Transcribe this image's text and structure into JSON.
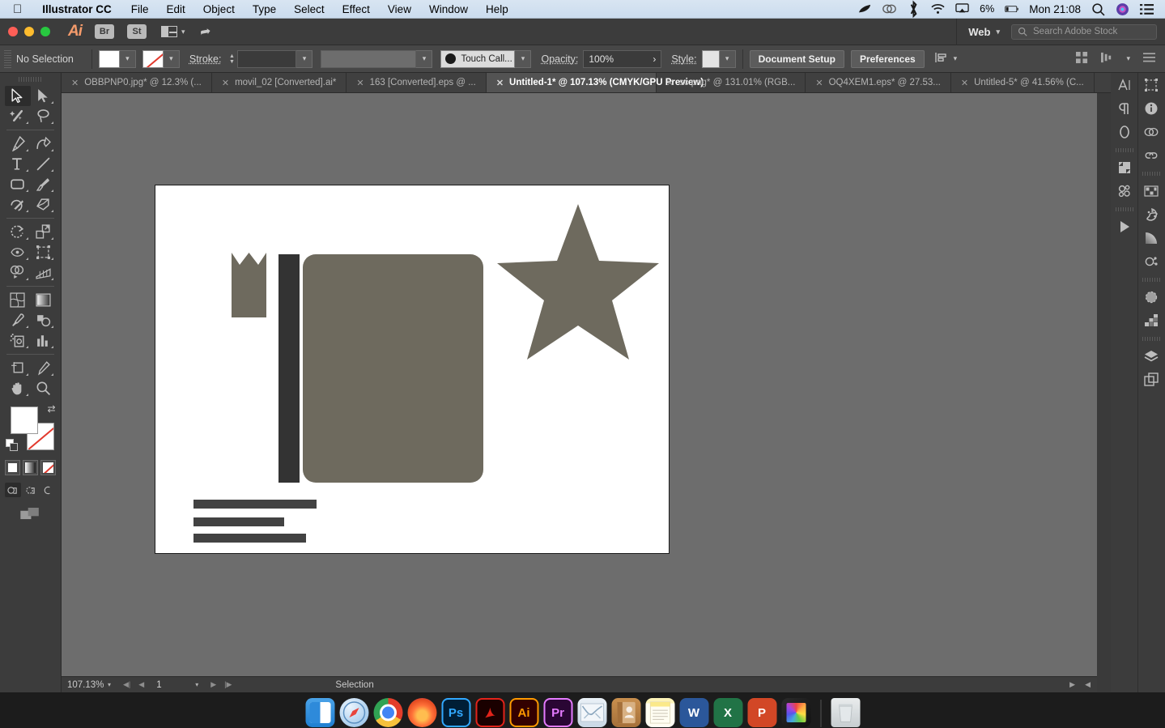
{
  "macos": {
    "apple_menu": "apple-logo",
    "app_name": "Illustrator CC",
    "menus": [
      "File",
      "Edit",
      "Object",
      "Type",
      "Select",
      "Effect",
      "View",
      "Window",
      "Help"
    ],
    "status_icons": [
      "feather-icon",
      "creative-cloud-icon",
      "bluetooth-icon",
      "wifi-icon",
      "airplay-icon"
    ],
    "battery_percent": "6%",
    "clock": "Mon 21:08",
    "right_icons": [
      "search-icon",
      "siri-icon",
      "notification-center-icon"
    ]
  },
  "app_bar": {
    "logo": "Ai",
    "bridge_label": "Br",
    "stock_label": "St",
    "arrange_icon": "arrange-documents-icon",
    "rocket_icon": "rocket-icon",
    "workspace": "Web",
    "search_placeholder": "Search Adobe Stock"
  },
  "control_bar": {
    "selection_status": "No Selection",
    "fill_swatch": "#ffffff",
    "stroke_swatch": "none",
    "stroke_label": "Stroke:",
    "stroke_weight": "",
    "stroke_profile": "",
    "brush_name": "Touch Call...",
    "opacity_label": "Opacity:",
    "opacity_value": "100%",
    "opacity_arrow": "›",
    "style_label": "Style:",
    "document_setup": "Document Setup",
    "preferences": "Preferences",
    "align_icon": "align-icon"
  },
  "tabs": [
    {
      "title": "OBBPNP0.jpg* @ 12.3% (...",
      "active": false
    },
    {
      "title": "movil_02 [Converted].ai*",
      "active": false
    },
    {
      "title": "163 [Converted].eps @ ...",
      "active": false
    },
    {
      "title": "Untitled-1* @ 107.13% (CMYK/GPU Preview)",
      "active": true
    },
    {
      "title": "sc.png* @ 131.01% (RGB...",
      "active": false
    },
    {
      "title": "OQ4XEM1.eps* @ 27.53...",
      "active": false
    },
    {
      "title": "Untitled-5* @ 41.56% (C...",
      "active": false
    }
  ],
  "tools": [
    {
      "name": "selection-tool",
      "active": true
    },
    {
      "name": "direct-selection-tool",
      "active": false
    },
    {
      "name": "magic-wand-tool",
      "active": false
    },
    {
      "name": "lasso-tool",
      "active": false
    },
    {
      "name": "pen-tool",
      "active": false
    },
    {
      "name": "curvature-tool",
      "active": false
    },
    {
      "name": "type-tool",
      "active": false
    },
    {
      "name": "line-segment-tool",
      "active": false
    },
    {
      "name": "rectangle-tool",
      "active": false
    },
    {
      "name": "paintbrush-tool",
      "active": false
    },
    {
      "name": "shaper-tool",
      "active": false
    },
    {
      "name": "eraser-tool",
      "active": false
    },
    {
      "name": "rotate-tool",
      "active": false
    },
    {
      "name": "scale-tool",
      "active": false
    },
    {
      "name": "width-tool",
      "active": false
    },
    {
      "name": "free-transform-tool",
      "active": false
    },
    {
      "name": "shape-builder-tool",
      "active": false
    },
    {
      "name": "perspective-grid-tool",
      "active": false
    },
    {
      "name": "mesh-tool",
      "active": false
    },
    {
      "name": "gradient-tool",
      "active": false
    },
    {
      "name": "eyedropper-tool",
      "active": false
    },
    {
      "name": "blend-tool",
      "active": false
    },
    {
      "name": "symbol-sprayer-tool",
      "active": false
    },
    {
      "name": "column-graph-tool",
      "active": false
    },
    {
      "name": "artboard-tool",
      "active": false
    },
    {
      "name": "slice-tool",
      "active": false
    },
    {
      "name": "hand-tool",
      "active": false
    },
    {
      "name": "zoom-tool",
      "active": false
    }
  ],
  "color_controls": {
    "fill": "#ffffff",
    "stroke": "none",
    "swap_icon": "swap-fill-stroke-icon",
    "default_icon": "default-fill-stroke-icon",
    "modes": [
      "color-mode-button",
      "gradient-mode-button",
      "none-mode-button"
    ],
    "draw_modes": [
      "draw-normal-button",
      "draw-behind-button",
      "draw-inside-button"
    ],
    "screen_mode": "change-screen-mode-button"
  },
  "artwork": {
    "fill_color": "#6e6a5e",
    "dark_color": "#333333",
    "text_bar_color": "#424242",
    "shapes": [
      "ribbon-bookmark",
      "book-spine",
      "book-cover",
      "star",
      "text-bar-1",
      "text-bar-2",
      "text-bar-3"
    ]
  },
  "status_bar": {
    "zoom_level": "107.13%",
    "artboard_number": "1",
    "tool_status": "Selection",
    "first_icon": "first-artboard-icon",
    "prev_icon": "prev-artboard-icon",
    "next_icon": "next-artboard-icon",
    "last_icon": "last-artboard-icon"
  },
  "right_dock": {
    "column_a": [
      "character-panel-icon",
      "paragraph-panel-icon",
      "opentype-panel-icon",
      "symbols-panel-icon",
      "brushes-panel-icon",
      "actions-panel-icon"
    ],
    "column_b": [
      "transform-panel-icon",
      "info-panel-icon",
      "cc-libraries-panel-icon",
      "links-panel-icon",
      "swatches-panel-icon",
      "color-guide-panel-icon",
      "gradient-panel-icon",
      "color-panel-icon",
      "appearance-panel-icon",
      "graphic-styles-panel-icon",
      "layers-panel-icon",
      "artboards-panel-icon"
    ]
  },
  "dock": {
    "apps": [
      {
        "name": "finder",
        "label": "",
        "running": true
      },
      {
        "name": "safari",
        "label": "",
        "running": true
      },
      {
        "name": "chrome",
        "label": "",
        "running": true
      },
      {
        "name": "firefox",
        "label": "",
        "running": true
      },
      {
        "name": "photoshop",
        "label": "Ps",
        "running": true
      },
      {
        "name": "acrobat",
        "label": "∴",
        "running": false
      },
      {
        "name": "illustrator",
        "label": "Ai",
        "running": true
      },
      {
        "name": "premiere",
        "label": "Pr",
        "running": false
      },
      {
        "name": "mail",
        "label": "",
        "running": false
      },
      {
        "name": "contacts",
        "label": "",
        "running": false
      },
      {
        "name": "notes",
        "label": "",
        "running": false
      },
      {
        "name": "word",
        "label": "W",
        "running": false
      },
      {
        "name": "excel",
        "label": "X",
        "running": false
      },
      {
        "name": "powerpoint",
        "label": "P",
        "running": false
      },
      {
        "name": "final-cut",
        "label": "",
        "running": false
      },
      {
        "name": "trash",
        "label": "",
        "running": false
      }
    ]
  }
}
